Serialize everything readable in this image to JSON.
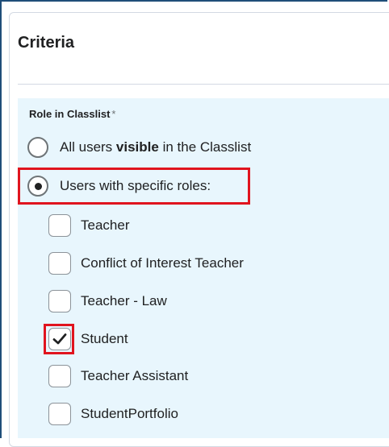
{
  "criteria": {
    "title": "Criteria",
    "role_field": {
      "label": "Role in Classlist",
      "required_marker": "*",
      "options": [
        {
          "label_prefix": "All users ",
          "label_bold": "visible",
          "label_suffix": " in the Classlist",
          "selected": false
        },
        {
          "label": "Users with specific roles:",
          "selected": true
        }
      ],
      "roles": [
        {
          "label": "Teacher",
          "checked": false
        },
        {
          "label": "Conflict of Interest Teacher",
          "checked": false
        },
        {
          "label": "Teacher - Law",
          "checked": false
        },
        {
          "label": "Student",
          "checked": true
        },
        {
          "label": "Teacher Assistant",
          "checked": false
        },
        {
          "label": "StudentPortfolio",
          "checked": false
        }
      ]
    }
  },
  "colors": {
    "section_background": "#e8f6fd",
    "highlight": "#e0141e",
    "frame_border": "#1f4e79"
  },
  "icons": {
    "radio_selected": "radio-selected-icon",
    "radio_unselected": "radio-unselected-icon",
    "checkmark": "checkmark-icon"
  }
}
